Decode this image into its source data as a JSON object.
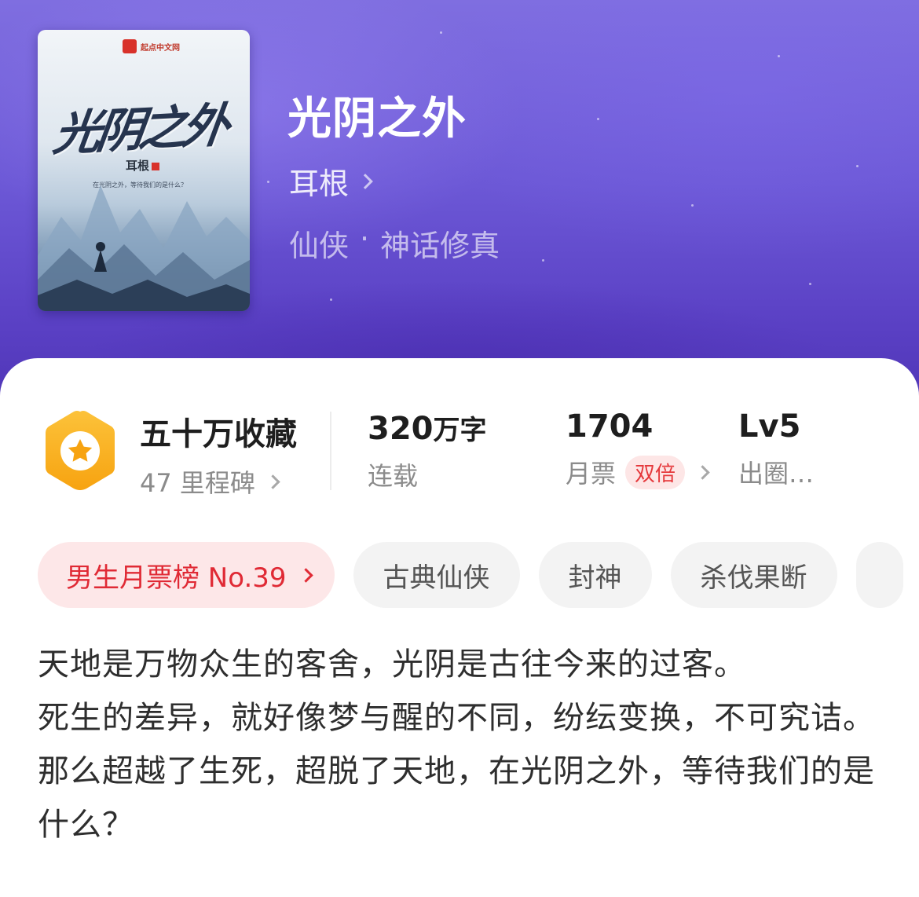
{
  "book": {
    "cover": {
      "publisher": "起点中文网",
      "title_art": "光阴之外",
      "author_art": "耳根",
      "tagline": "在光阴之外，等待我们的是什么？"
    },
    "title": "光阴之外",
    "author": "耳根",
    "genre": "仙侠",
    "genre_separator": "·",
    "subgenre": "神话修真"
  },
  "stats": {
    "collect": {
      "main": "五十万收藏",
      "sub": "47 里程碑",
      "badge_icon": "star-icon"
    },
    "words": {
      "value": "320",
      "unit": "万字",
      "sub": "连载"
    },
    "monthly_vote": {
      "value": "1704",
      "sub": "月票",
      "badge": "双倍"
    },
    "level": {
      "value": "Lv5",
      "sub": "出圈…"
    }
  },
  "tags": {
    "rank": "男生月票榜 No.39",
    "items": [
      "古典仙侠",
      "封神",
      "杀伐果断"
    ]
  },
  "synopsis": [
    "天地是万物众生的客舍，光阴是古往今来的过客。",
    "死生的差异，就好像梦与醒的不同，纷纭变换，不可究诘。",
    "那么超越了生死，超脱了天地，在光阴之外，等待我们的是什么？"
  ],
  "colors": {
    "header_purple": "#6c58d6",
    "rank_red": "#e02a35",
    "badge_orange": "#fbb61e",
    "double_badge_bg": "#fde6e6"
  }
}
